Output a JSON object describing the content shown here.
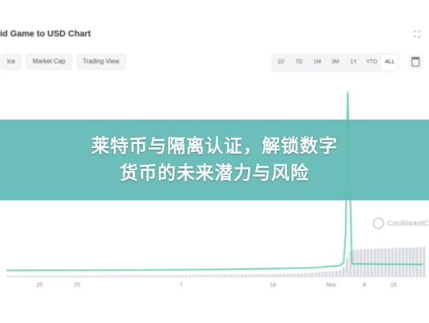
{
  "header": {
    "title": "id Game to USD Chart",
    "expand_icon": "expand-icon"
  },
  "chart_tabs": [
    {
      "label": "ice"
    },
    {
      "label": "Market Cap"
    },
    {
      "label": "Trading View"
    }
  ],
  "range_buttons": [
    {
      "label": "1D",
      "active": false
    },
    {
      "label": "7D",
      "active": false
    },
    {
      "label": "1M",
      "active": false
    },
    {
      "label": "3M",
      "active": false
    },
    {
      "label": "1Y",
      "active": false
    },
    {
      "label": "YTD",
      "active": false
    },
    {
      "label": "ALL",
      "active": true
    }
  ],
  "calendar_icon": "calendar-icon",
  "watermark": {
    "text": "CoinMarketCap",
    "icon": "coinmarketcap-logo-icon"
  },
  "banner": {
    "line1": "莱特币与隔离认证，解锁数字",
    "line2": "货币的未来潜力与风险"
  },
  "colors": {
    "price_line": "#4fcf9e",
    "volume_bar": "#d8dbe0",
    "banner_bg": "#60b9b4"
  },
  "chart_data": {
    "type": "line",
    "x_tick_labels": [
      "20",
      "25",
      "7",
      "14",
      "Nov",
      "8",
      "15"
    ],
    "x": [
      0,
      0.1,
      0.2,
      0.3,
      0.4,
      0.5,
      0.6,
      0.7,
      0.75,
      0.8,
      0.81,
      0.815,
      0.82,
      0.83,
      0.9,
      1.0
    ],
    "series": [
      {
        "values": [
          1,
          1.05,
          1.1,
          1.2,
          1.35,
          1.5,
          1.8,
          2.2,
          2.6,
          3.5,
          5,
          20,
          95,
          4.5,
          4.3,
          4.2
        ]
      }
    ],
    "volume": [
      1,
      1.2,
      1.1,
      1.4,
      1.5,
      1.8,
      2,
      2.6,
      3.5,
      5,
      8,
      14,
      18,
      20,
      21,
      22
    ],
    "grid": false
  }
}
